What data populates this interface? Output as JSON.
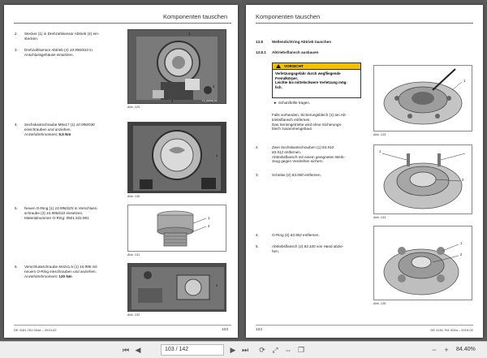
{
  "left_page": {
    "header": "Komponenten tauschen",
    "steps": [
      {
        "no": "2.",
        "lines": [
          "Stecker (1) in Drehzahlsensor Abtrieb (4) ein-",
          "stecken."
        ]
      },
      {
        "no": "3.",
        "l1": "Drehzahlsensor Abtrieb (4) ",
        "l1i": "10.990/810",
        "l1b": " in",
        "l2": "Anschlussgehäuse einsetzen."
      },
      {
        "no": "4.",
        "l1": "Sechskantschraube M6x17 (1) ",
        "l1i": "10.990/030",
        "l2": "einschrauben und anziehen.",
        "l3": "Anziehdrehmoment: ",
        "l3b": "9,5 Nm"
      },
      {
        "no": "5.",
        "l1": "Neuen O-Ring (1) ",
        "l1i": "10.996/025",
        "l1b": " in Verschluss-",
        "l2": "schraube (2) ",
        "l2i": "10.996/610",
        "l2b": " einsetzen.",
        "l3": "Materialnummer O-Ring: 0501.322.981"
      },
      {
        "no": "6.",
        "l1": "Verschlussschraube M42x1,5 (1) ",
        "l1i": "10.996",
        "l1b": " mit",
        "l2": "neuem O-Ring einschrauben und anziehen.",
        "l3": "Anziehdrehmoment: ",
        "l3b": "120 Nm"
      }
    ],
    "figures": [
      {
        "caption": "Abb. 129",
        "code": "TL_02430_01",
        "callouts": [
          "1",
          "4",
          "3"
        ]
      },
      {
        "caption": "Abb. 130",
        "code": "TL_02431_01",
        "callouts": [
          "1"
        ]
      },
      {
        "caption": "Abb. 131",
        "code": "TL_02457_01",
        "callouts": [
          "1",
          "2"
        ]
      },
      {
        "caption": "Abb. 132",
        "code": "TL_02458_01",
        "callouts": [
          "1"
        ]
      }
    ],
    "footer": "DE 4181.761.004a – 2019-02",
    "page_number": "103"
  },
  "right_page": {
    "header": "Komponenten tauschen",
    "section_no": "13.8",
    "section_title": "Wellendichtring Abtrieb tauschen",
    "subsection_no": "13.8.1",
    "subsection_title": "Abtriebsflansch ausbauen",
    "warning": {
      "label": "VORSICHT",
      "lines": [
        "Verletzungsgefahr durch wegfliegende",
        "Fremdkörper.",
        "Leichte bis mittelschwere Verletzung mög-",
        "lich."
      ],
      "action": "► Schutzbrille tragen."
    },
    "intro": [
      "Falls vorhanden, Sicherungsblech (1) am Ab-",
      "triebsflansch entfernen.",
      "Das Seriengetriebe wird ohne Sicherungs-",
      "blech zusammengebaut."
    ],
    "steps": [
      {
        "no": "2.",
        "l1": "Zwei Sechskantschrauben (1) ",
        "l1i": "83.910",
        "l2i": "83.912",
        "l2": " entfernen.",
        "l3": "Abtriebsflansch mit einem geeigneten Werk-",
        "l4": "zeug gegen Verdrehen sichern."
      },
      {
        "no": "3.",
        "l1": "Scheibe (2) ",
        "l1i": "83.900",
        "l1b": " entfernen."
      },
      {
        "no": "4.",
        "l1": "O-Ring (2) ",
        "l1i": "83.902",
        "l1b": " entfernen."
      },
      {
        "no": "5.",
        "l1": "Abtriebsflansch (2) ",
        "l1i": "83.100",
        "l1b": " von Hand abzie-",
        "l2": "hen."
      }
    ],
    "figures": [
      {
        "caption": "Abb. 133",
        "code": "TL_02459_01",
        "callouts": [
          "1"
        ]
      },
      {
        "caption": "Abb. 134",
        "code": "TL_02460_01",
        "callouts": [
          "1",
          "2"
        ]
      },
      {
        "caption": "Abb. 135",
        "code": "TL_02461_01",
        "callouts": [
          "1",
          "2"
        ]
      }
    ],
    "footer": "DE 4181.761.004a – 2019-02",
    "page_number": "104"
  },
  "toolbar": {
    "page_current": "103",
    "page_total": "142",
    "page_display": "103 / 142",
    "zoom": "84.40%"
  },
  "colors": {
    "warning_yellow": "#f2c200",
    "viewer_bg": "#5b5b5b",
    "toolbar_bg": "#eeeeee"
  }
}
